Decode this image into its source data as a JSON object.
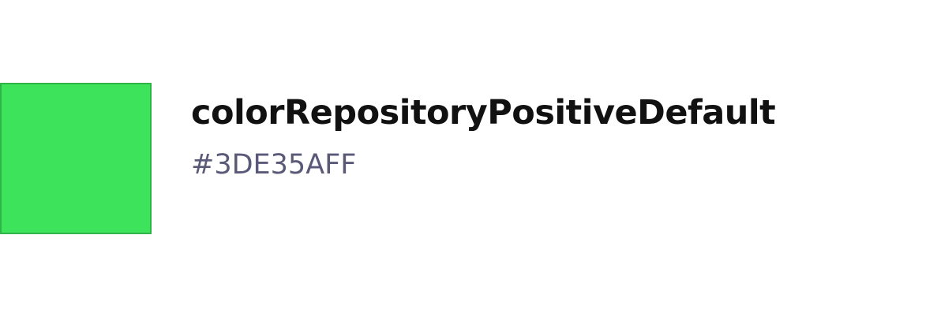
{
  "token": {
    "name": "colorRepositoryPositiveDefault",
    "value": "#3DE35AFF",
    "swatch_color": "#3DE35A",
    "swatch_border_color": "#2fb44a"
  },
  "colors": {
    "name_text": "#111111",
    "value_text": "#5a5a78",
    "background": "#ffffff"
  }
}
